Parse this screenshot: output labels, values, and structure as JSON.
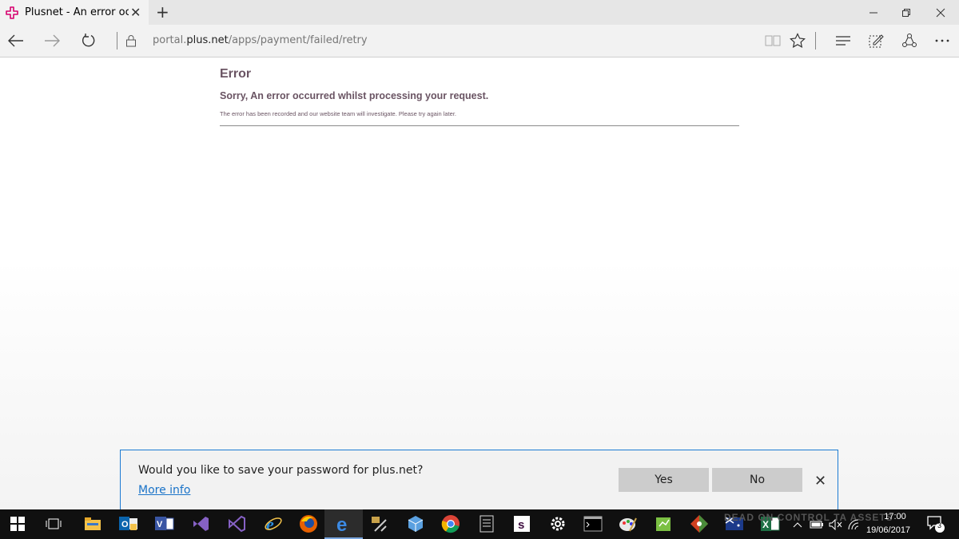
{
  "browser": {
    "tab_title": "Plusnet - An error occurred",
    "url_prefix": "portal.",
    "url_host": "plus.net",
    "url_path": "/apps/payment/failed/retry"
  },
  "page": {
    "heading": "Error",
    "subheading": "Sorry, An error occurred whilst processing your request.",
    "message": "The error has been recorded and our website team will investigate. Please try again later."
  },
  "password_prompt": {
    "question": "Would you like to save your password for plus.net?",
    "more_info": "More info",
    "yes_label": "Yes",
    "no_label": "No"
  },
  "taskbar": {
    "time": "17:00",
    "date": "19/06/2017",
    "notification_count": "3",
    "watermark": "DEAD ON CONTROL TA ASSETS"
  },
  "colors": {
    "brand_pink": "#d6006e",
    "error_text": "#6a5463",
    "link_blue": "#1a73c8",
    "prompt_border": "#1c7bd3"
  }
}
